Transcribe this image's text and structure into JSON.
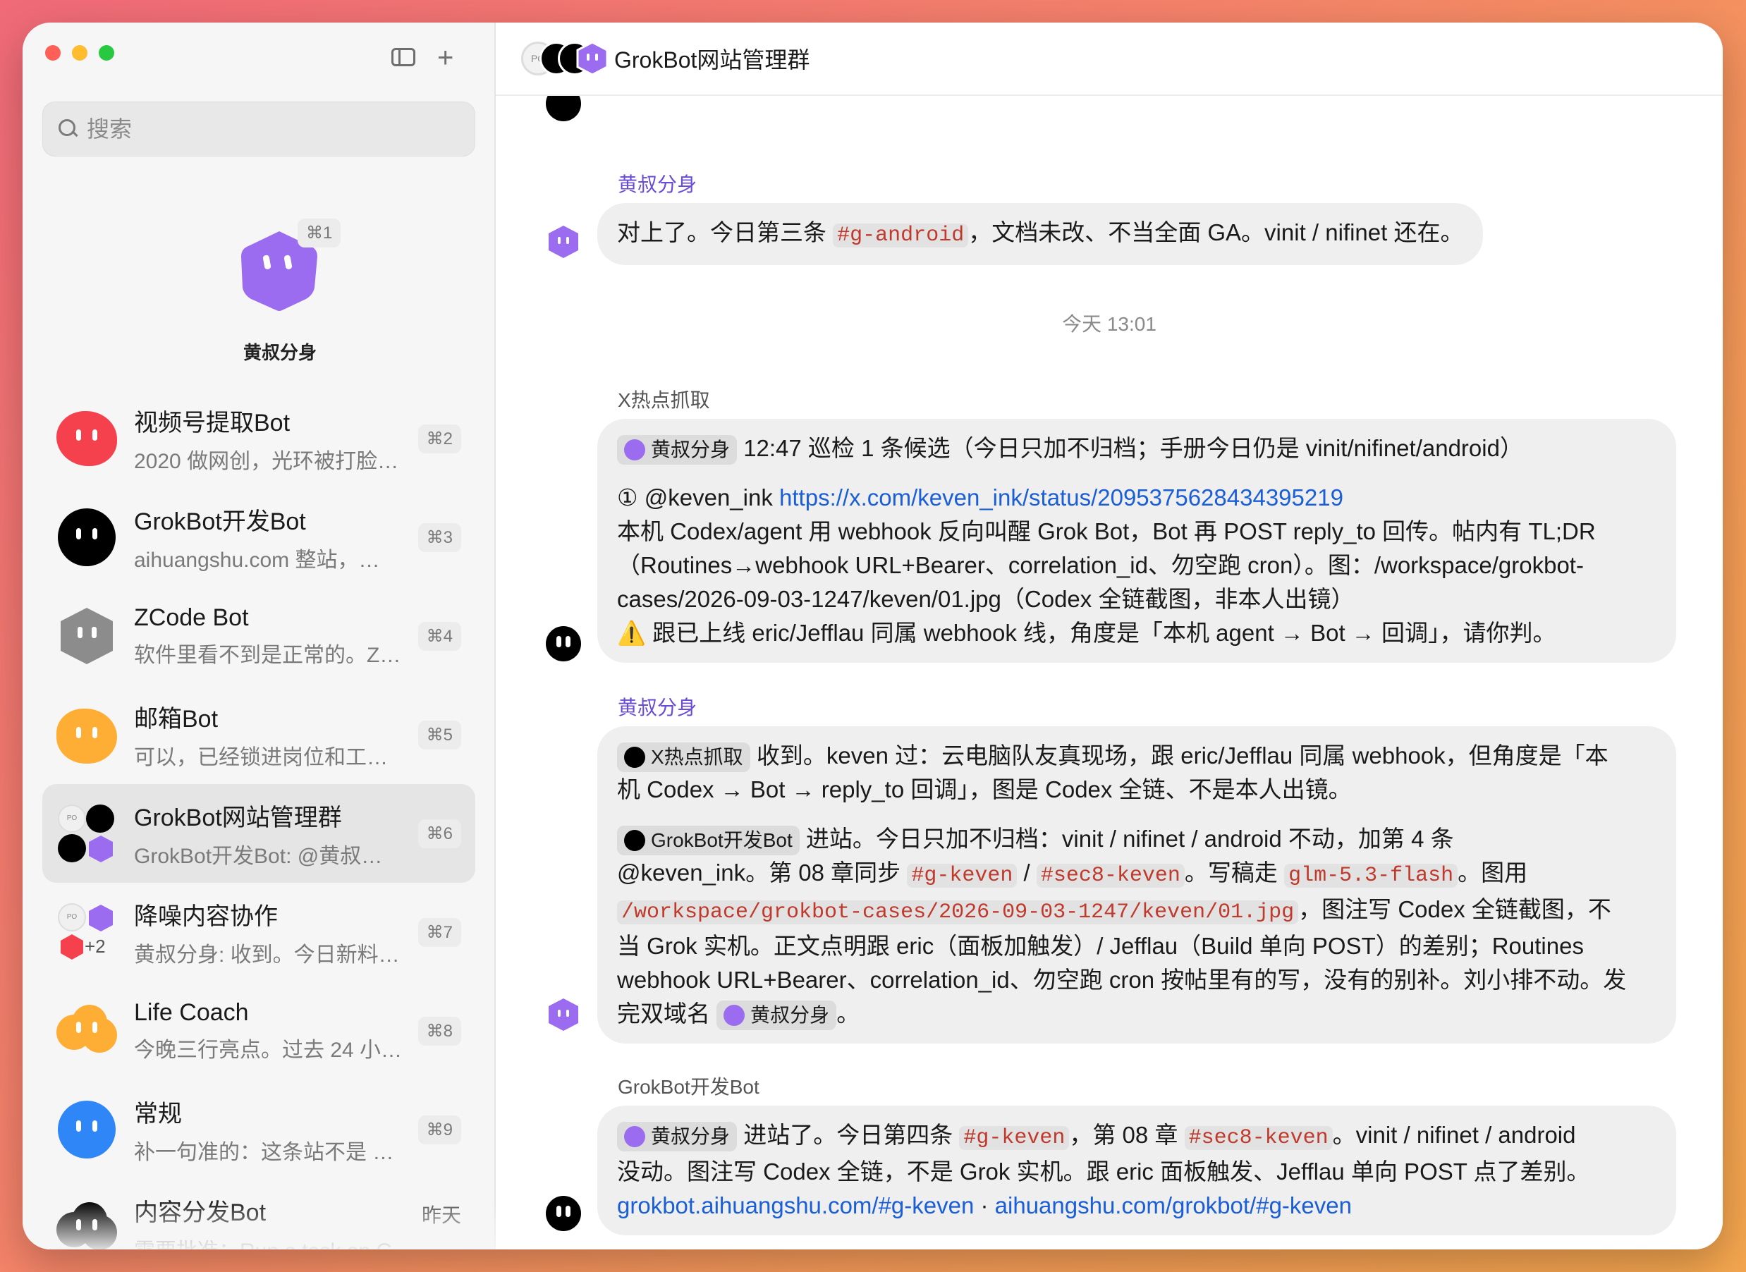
{
  "sidebar": {
    "search_placeholder": "搜索",
    "pinned": {
      "name": "黄叔分身",
      "shortcut": "⌘1",
      "color": "#9b6bf0"
    },
    "conversations": [
      {
        "name": "视频号提取Bot",
        "preview": "2020 做网创，光环被打脸…",
        "shortcut": "⌘2",
        "color": "#f5404d"
      },
      {
        "name": "GrokBot开发Bot",
        "preview": "aihuangshu.com 整站，…",
        "shortcut": "⌘3",
        "color": "#000000"
      },
      {
        "name": "ZCode Bot",
        "preview": "软件里看不到是正常的。Z…",
        "shortcut": "⌘4",
        "color": "#8c8c8c"
      },
      {
        "name": "邮箱Bot",
        "preview": "可以，已经锁进岗位和工…",
        "shortcut": "⌘5",
        "color": "#ffae35"
      },
      {
        "name": "GrokBot网站管理群",
        "preview": "GrokBot开发Bot: @黄叔…",
        "shortcut": "⌘6",
        "color": "#9b6bf0"
      },
      {
        "name": "降噪内容协作",
        "preview": "黄叔分身: 收到。今日新料…",
        "shortcut": "⌘7",
        "color": "#9b6bf0",
        "badge": "+2"
      },
      {
        "name": "Life Coach",
        "preview": "今晚三行亮点。过去 24 小…",
        "shortcut": "⌘8",
        "color": "#ffae35"
      },
      {
        "name": "常规",
        "preview": "补一句准的：这条站不是 …",
        "shortcut": "⌘9",
        "color": "#2f86f6"
      },
      {
        "name": "内容分发Bot",
        "preview": "需要批准：Run a task on Grok …",
        "time": "昨天",
        "color": "#000000"
      }
    ]
  },
  "chat": {
    "title": "GrokBot网站管理群",
    "header_avatar_text": "PO",
    "messages": {
      "m1": {
        "sender": "黄叔分身",
        "t1": "对上了。今日第三条 ",
        "c1": "#g-android",
        "t2": "，文档未改、不当全面 GA。vinit / nifinet 还在。"
      },
      "timestamp": "今天 13:01",
      "m2": {
        "sender": "X热点抓取",
        "chip": "黄叔分身",
        "line1": "12:47 巡检 1 条候选（今日只加不归档；手册今日仍是 vinit/nifinet/android）",
        "line2a": "① @keven_ink ",
        "line2_link": "https://x.com/keven_ink/status/2095375628434395219",
        "line3": "本机 Codex/agent 用 webhook 反向叫醒 Grok Bot，Bot 再 POST reply_to 回传。帖内有 TL;DR",
        "line4": "（Routines→webhook URL+Bearer、correlation_id、勿空跑 cron）。图：/workspace/grokbot-",
        "line5": "cases/2026-09-03-1247/keven/01.jpg（Codex 全链截图，非本人出镜）",
        "line6": "⚠️ 跟已上线 eric/Jefflau 同属 webhook 线，角度是「本机 agent → Bot → 回调」，请你判。"
      },
      "m3": {
        "sender": "黄叔分身",
        "chip1": "X热点抓取",
        "p1a": "收到。keven 过：云电脑队友真现场，跟 eric/Jefflau 同属 webhook，但角度是「本",
        "p1b": "机 Codex → Bot → reply_to 回调」，图是 Codex 全链、不是本人出镜。",
        "chip2": "GrokBot开发Bot",
        "p2a": "进站。今日只加不归档：vinit / nifinet / android 不动，加第 4 条",
        "p2b": "@keven_ink。第 08 章同步 ",
        "c1": "#g-keven",
        "sep": " / ",
        "c2": "#sec8-keven",
        "p2c": "。写稿走 ",
        "c3": "glm-5.3-flash",
        "p2d": "。图用",
        "c4": "/workspace/grokbot-cases/2026-09-03-1247/keven/01.jpg",
        "p2e": "，图注写 Codex 全链截图，不",
        "p2f": "当 Grok 实机。正文点明跟 eric（面板加触发）/ Jefflau（Build 单向 POST）的差别；Routines",
        "p2g": "webhook URL+Bearer、correlation_id、勿空跑 cron 按帖里有的写，没有的别补。刘小排不动。发",
        "p2h": "完双域名 ",
        "chip3": "黄叔分身",
        "p2i": "。"
      },
      "m4": {
        "sender": "GrokBot开发Bot",
        "chip": "黄叔分身",
        "t1": "进站了。今日第四条 ",
        "c1": "#g-keven",
        "t2": "，第 08 章 ",
        "c2": "#sec8-keven",
        "t3": "。vinit / nifinet / android",
        "line2": "没动。图注写 Codex 全链，不是 Grok 实机。跟 eric 面板触发、Jefflau 单向 POST 点了差别。",
        "link1": "grokbot.aihuangshu.com/#g-keven",
        "dot": " · ",
        "link2": "aihuangshu.com/grokbot/#g-keven"
      }
    }
  },
  "colors": {
    "accent_purple": "#6a4bd6",
    "link_blue": "#1a5fd6",
    "code_red": "#c0392b"
  }
}
